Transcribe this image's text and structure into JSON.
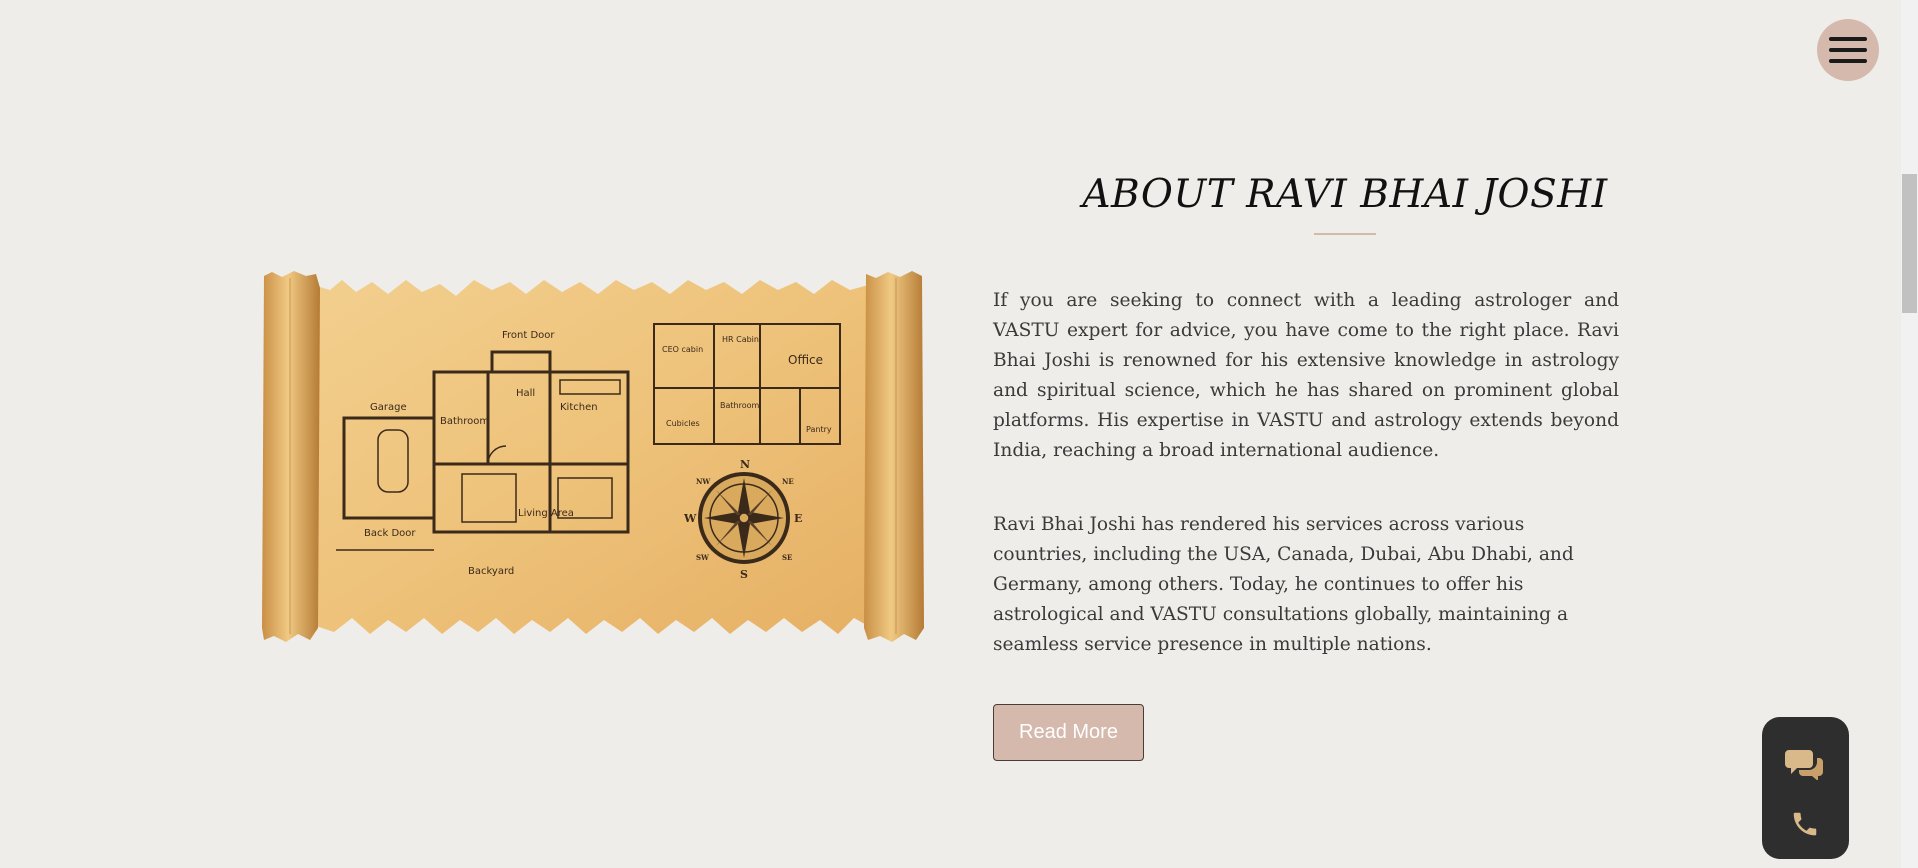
{
  "header": {
    "menu_icon": "hamburger-menu-icon"
  },
  "about": {
    "title": "ABOUT RAVI BHAI JOSHI",
    "image": {
      "labels": {
        "front_door": "Front Door",
        "garage": "Garage",
        "bathroom": "Bathroom",
        "hall": "Hall",
        "kitchen": "Kitchen",
        "living_area": "Living Area",
        "back_door": "Back Door",
        "backyard": "Backyard",
        "ceo_cabin": "CEO cabin",
        "hr_cabin": "HR Cabin",
        "office": "Office",
        "office_bathroom": "Bathroom",
        "cubicles": "Cubicles",
        "pantry": "Pantry",
        "compass_n": "N",
        "compass_s": "S",
        "compass_e": "E",
        "compass_w": "W",
        "compass_ne": "NE",
        "compass_nw": "NW",
        "compass_se": "SE",
        "compass_sw": "SW"
      }
    },
    "paragraph1": "If you are seeking to connect with a leading astrologer and VASTU expert for advice, you have come to the right place. Ravi Bhai Joshi is renowned for his extensive knowledge in astrology and spiritual science, which he has shared on prominent global platforms. His expertise in VASTU and astrology extends beyond India, reaching a broad international audience.",
    "paragraph2": "Ravi Bhai Joshi has rendered his services across various countries, including the USA, Canada, Dubai, Abu Dhabi, and Germany, among others. Today, he continues to offer his astrological and VASTU consultations globally, maintaining a seamless service presence in multiple nations.",
    "read_more_label": "Read More"
  },
  "contact_widget": {
    "chat_icon": "chat-bubbles-icon",
    "call_icon": "phone-icon"
  },
  "colors": {
    "background": "#eeede9",
    "accent": "#d4b9ac",
    "widget": "#2e2e2e",
    "widget_icon": "#d9b98a"
  }
}
